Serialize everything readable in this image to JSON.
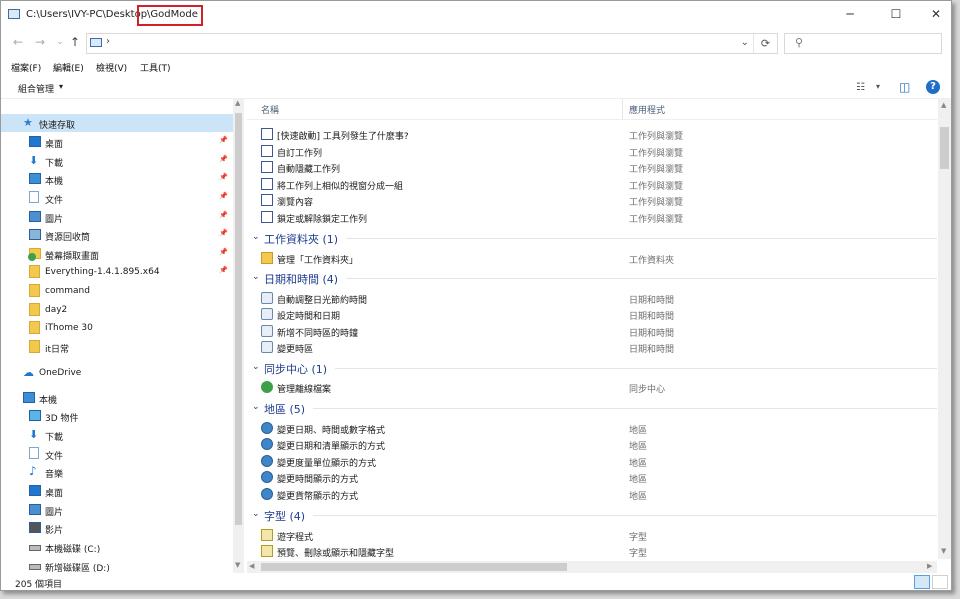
{
  "window": {
    "path_prefix": "C:\\Users\\IVY-PC\\Desktop\\",
    "path_highlight": "GodMode",
    "minimize": "─",
    "maximize": "☐",
    "close": "✕"
  },
  "address": {
    "back": "←",
    "forward": "→",
    "recent": "⌄",
    "up": "↑",
    "separator": "›",
    "dropdown": "⌄",
    "refresh": "⟳",
    "search_icon": "⚲"
  },
  "menu": [
    "檔案(F)",
    "編輯(E)",
    "檢視(V)",
    "工具(T)"
  ],
  "command_bar": {
    "organize": "組合管理",
    "arrow": "▾",
    "view_icon": "☷",
    "view_arrow": "▾",
    "pane_icon": "◫",
    "help": "?"
  },
  "nav_pane": {
    "items": [
      {
        "label": "快速存取",
        "icon": "star-icon",
        "color": "#2f7bd8",
        "pinned": false,
        "selected": true
      },
      {
        "label": "桌面",
        "icon": "desktop-icon",
        "color": "#1f77d0",
        "pinned": true
      },
      {
        "label": "下載",
        "icon": "download-icon",
        "color": "#1f77d0",
        "pinned": true
      },
      {
        "label": "本機",
        "icon": "computer-icon",
        "color": "#3b8fd8",
        "pinned": true
      },
      {
        "label": "文件",
        "icon": "document-icon",
        "color": "#7fa8d0",
        "pinned": true
      },
      {
        "label": "圖片",
        "icon": "pictures-icon",
        "color": "#4b90cf",
        "pinned": true
      },
      {
        "label": "資源回收筒",
        "icon": "recycle-bin-icon",
        "color": "#8ab4d8",
        "pinned": true
      },
      {
        "label": "螢幕擷取畫面",
        "icon": "screenshot-folder-icon",
        "color": "#3fa04a",
        "pinned": true
      },
      {
        "label": "Everything-1.4.1.895.x64",
        "icon": "folder-icon",
        "color": "#f3c94d",
        "pinned": true
      },
      {
        "label": "command",
        "icon": "folder-icon",
        "color": "#f3c94d",
        "pinned": false
      },
      {
        "label": "day2",
        "icon": "folder-icon",
        "color": "#f3c94d",
        "pinned": false
      },
      {
        "label": "iThome 30",
        "icon": "folder-icon",
        "color": "#f3c94d",
        "pinned": false
      },
      {
        "label": "it日常",
        "icon": "folder-icon",
        "color": "#f3c94d",
        "pinned": false
      },
      {
        "label": "OneDrive",
        "icon": "onedrive-icon",
        "color": "#1f77d0",
        "pinned": false
      },
      {
        "label": "本機",
        "icon": "computer-icon",
        "color": "#3b8fd8",
        "pinned": false
      },
      {
        "label": "3D 物件",
        "icon": "3d-objects-icon",
        "color": "#58b5e8",
        "pinned": false
      },
      {
        "label": "下載",
        "icon": "download-icon",
        "color": "#1f77d0",
        "pinned": false
      },
      {
        "label": "文件",
        "icon": "document-icon",
        "color": "#7fa8d0",
        "pinned": false
      },
      {
        "label": "音樂",
        "icon": "music-icon",
        "color": "#1f77d0",
        "pinned": false
      },
      {
        "label": "桌面",
        "icon": "desktop-icon",
        "color": "#1f77d0",
        "pinned": false
      },
      {
        "label": "圖片",
        "icon": "pictures-icon",
        "color": "#4b90cf",
        "pinned": false
      },
      {
        "label": "影片",
        "icon": "video-icon",
        "color": "#555555",
        "pinned": false
      },
      {
        "label": "本機磁碟 (C:)",
        "icon": "drive-icon",
        "color": "#666666",
        "pinned": false
      },
      {
        "label": "新增磁碟區 (D:)",
        "icon": "drive-icon",
        "color": "#666666",
        "pinned": false
      }
    ]
  },
  "columns": {
    "name": "名稱",
    "app": "應用程式",
    "sort_caret": "^"
  },
  "content": [
    {
      "kind": "item",
      "name": "[快速啟動] 工具列發生了什麼事?",
      "app": "工作列與瀏覽",
      "icon": "taskbar-icon"
    },
    {
      "kind": "item",
      "name": "自訂工作列",
      "app": "工作列與瀏覽",
      "icon": "taskbar-icon"
    },
    {
      "kind": "item",
      "name": "自動隱藏工作列",
      "app": "工作列與瀏覽",
      "icon": "taskbar-icon"
    },
    {
      "kind": "item",
      "name": "將工作列上相似的視窗分成一組",
      "app": "工作列與瀏覽",
      "icon": "taskbar-icon"
    },
    {
      "kind": "item",
      "name": "瀏覽內容",
      "app": "工作列與瀏覽",
      "icon": "taskbar-icon"
    },
    {
      "kind": "item",
      "name": "鎖定或解除鎖定工作列",
      "app": "工作列與瀏覽",
      "icon": "taskbar-icon"
    },
    {
      "kind": "group",
      "name": "工作資料夾 (1)"
    },
    {
      "kind": "item",
      "name": "管理「工作資料夾」",
      "app": "工作資料夾",
      "icon": "work-folders-icon"
    },
    {
      "kind": "group",
      "name": "日期和時間 (4)"
    },
    {
      "kind": "item",
      "name": "自動調整日光節約時間",
      "app": "日期和時間",
      "icon": "clock-icon"
    },
    {
      "kind": "item",
      "name": "設定時間和日期",
      "app": "日期和時間",
      "icon": "clock-icon"
    },
    {
      "kind": "item",
      "name": "新增不同時區的時鐘",
      "app": "日期和時間",
      "icon": "clock-icon"
    },
    {
      "kind": "item",
      "name": "變更時區",
      "app": "日期和時間",
      "icon": "clock-icon"
    },
    {
      "kind": "group",
      "name": "同步中心 (1)"
    },
    {
      "kind": "item",
      "name": "管理離線檔案",
      "app": "同步中心",
      "icon": "sync-icon"
    },
    {
      "kind": "group",
      "name": "地區 (5)"
    },
    {
      "kind": "item",
      "name": "變更日期、時間或數字格式",
      "app": "地區",
      "icon": "globe-clock-icon"
    },
    {
      "kind": "item",
      "name": "變更日期和清單顯示的方式",
      "app": "地區",
      "icon": "globe-clock-icon"
    },
    {
      "kind": "item",
      "name": "變更度量單位顯示的方式",
      "app": "地區",
      "icon": "globe-clock-icon"
    },
    {
      "kind": "item",
      "name": "變更時間顯示的方式",
      "app": "地區",
      "icon": "globe-clock-icon"
    },
    {
      "kind": "item",
      "name": "變更貨幣顯示的方式",
      "app": "地區",
      "icon": "globe-clock-icon"
    },
    {
      "kind": "group",
      "name": "字型 (4)"
    },
    {
      "kind": "item",
      "name": "遊字程式",
      "app": "字型",
      "icon": "font-icon"
    },
    {
      "kind": "item",
      "name": "預覽、刪除或顯示和隱藏字型",
      "app": "字型",
      "icon": "font-icon"
    }
  ],
  "status": {
    "count": "205 個項目"
  },
  "colors": {
    "group_heading": "#1e3d8f",
    "selection": "#cce4f7",
    "highlight_box": "#d0202a"
  }
}
